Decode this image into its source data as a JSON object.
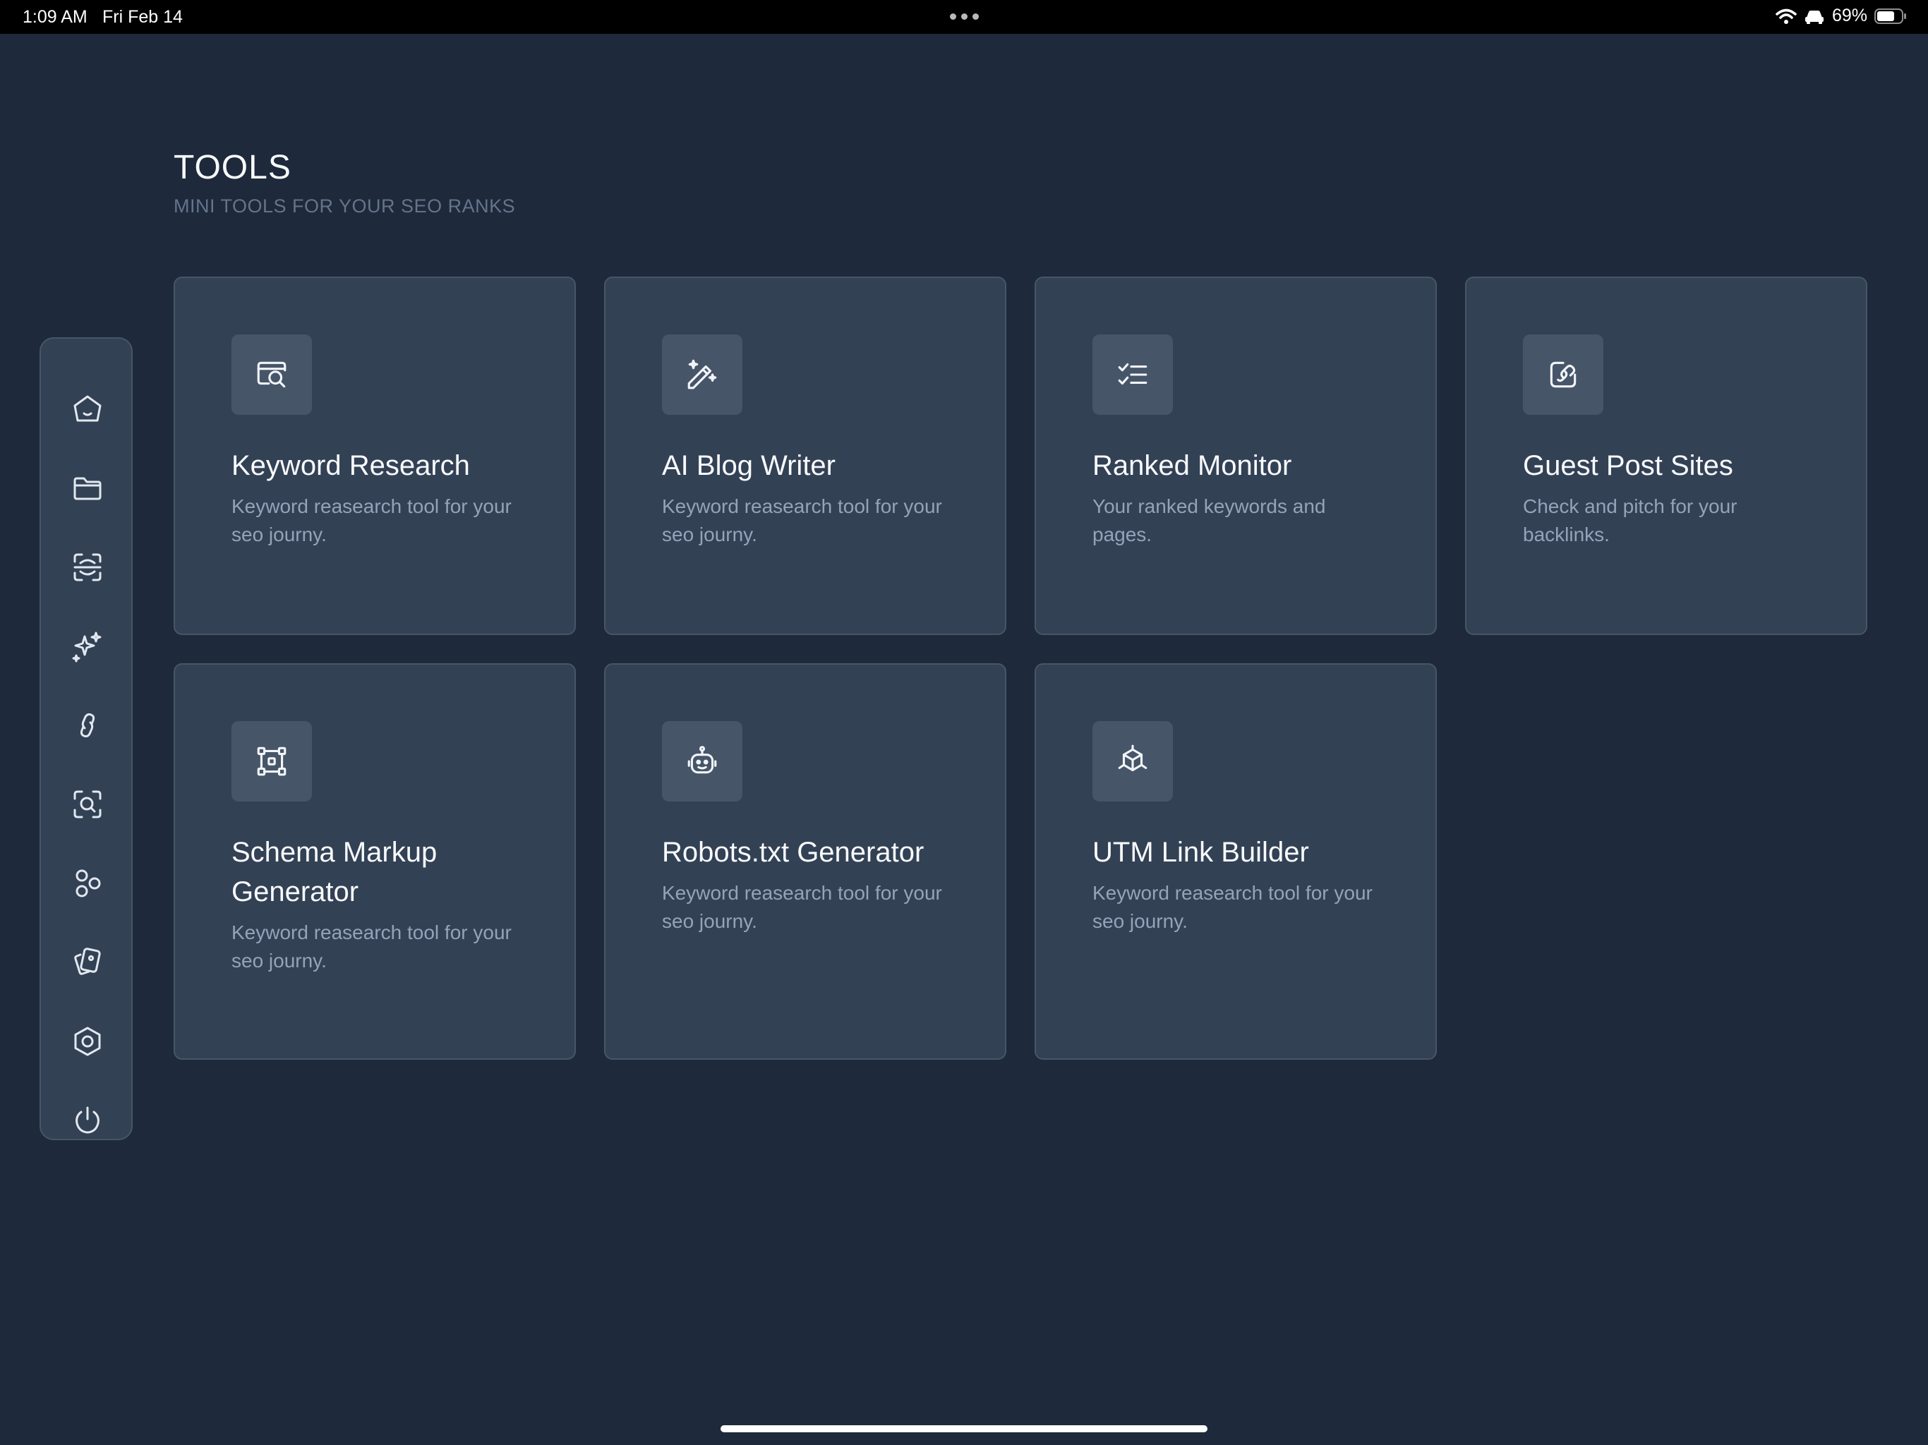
{
  "status_bar": {
    "time": "1:09 AM",
    "date": "Fri Feb 14",
    "battery": "69%"
  },
  "header": {
    "title": "TOOLS",
    "subtitle": "MINI TOOLS FOR YOUR SEO RANKS"
  },
  "sidebar": {
    "items": [
      {
        "icon": "home-icon"
      },
      {
        "icon": "folder-icon"
      },
      {
        "icon": "scan-text-icon"
      },
      {
        "icon": "sparkles-icon"
      },
      {
        "icon": "link-icon"
      },
      {
        "icon": "scan-search-icon"
      },
      {
        "icon": "shapes-icon"
      },
      {
        "icon": "cards-icon"
      },
      {
        "icon": "settings-hexagon-icon"
      },
      {
        "icon": "power-icon"
      }
    ]
  },
  "tools": [
    {
      "icon": "search-browser-icon",
      "title": "Keyword Research",
      "description": "Keyword reasearch tool for your seo journy."
    },
    {
      "icon": "wand-pen-icon",
      "title": "AI Blog Writer",
      "description": "Keyword reasearch tool for your seo journy."
    },
    {
      "icon": "list-checks-icon",
      "title": "Ranked Monitor",
      "description": "Your ranked keywords and pages."
    },
    {
      "icon": "external-link-edit-icon",
      "title": "Guest Post Sites",
      "description": "Check and pitch for your backlinks."
    },
    {
      "icon": "schema-icon",
      "title": "Schema Markup Generator",
      "description": "Keyword reasearch tool for your seo journy."
    },
    {
      "icon": "robot-icon",
      "title": "Robots.txt Generator",
      "description": "Keyword reasearch tool for your seo journy."
    },
    {
      "icon": "box-axis-icon",
      "title": "UTM Link Builder",
      "description": "Keyword reasearch tool for your seo journy."
    }
  ],
  "colors": {
    "background": "#1e293b",
    "card": "#334155",
    "card_border": "#475569",
    "icon_tile": "#475569",
    "muted_text": "#94a3b8"
  }
}
